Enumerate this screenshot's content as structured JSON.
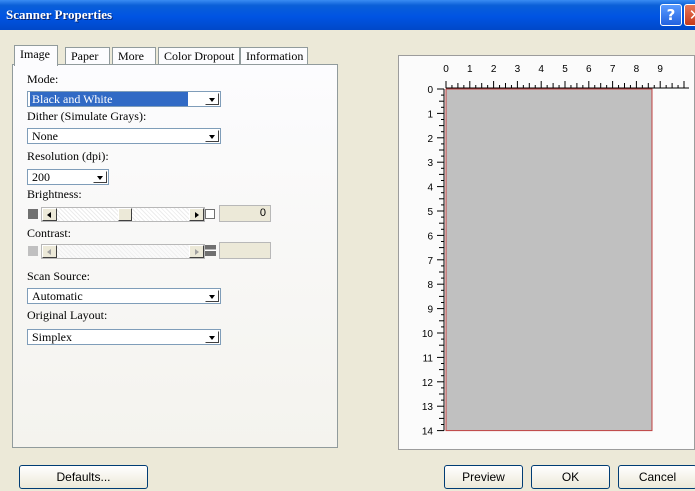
{
  "window": {
    "title": "Scanner Properties",
    "help_glyph": "?",
    "close_glyph": "✕"
  },
  "tabs": [
    {
      "label": "Image"
    },
    {
      "label": "Paper"
    },
    {
      "label": "More"
    },
    {
      "label": "Color Dropout"
    },
    {
      "label": "Information"
    }
  ],
  "image_tab": {
    "mode": {
      "label": "Mode:",
      "value": "Black and White"
    },
    "dither": {
      "label": "Dither (Simulate Grays):",
      "value": "None"
    },
    "resolution": {
      "label": "Resolution (dpi):",
      "value": "200"
    },
    "brightness": {
      "label": "Brightness:",
      "value": "0"
    },
    "contrast": {
      "label": "Contrast:",
      "value": ""
    },
    "scan_source": {
      "label": "Scan Source:",
      "value": "Automatic"
    },
    "original_layout": {
      "label": "Original Layout:",
      "value": "Simplex"
    }
  },
  "preview": {
    "x_ticks": [
      "0",
      "1",
      "2",
      "3",
      "4",
      "5",
      "6",
      "7",
      "8",
      "9"
    ],
    "y_ticks": [
      "0",
      "1",
      "2",
      "3",
      "4",
      "5",
      "6",
      "7",
      "8",
      "9",
      "10",
      "11",
      "12",
      "13",
      "14"
    ],
    "page_color": "#c0c0c0",
    "page_border_color": "#c04040"
  },
  "buttons": {
    "defaults": "Defaults...",
    "preview": "Preview",
    "ok": "OK",
    "cancel": "Cancel"
  }
}
